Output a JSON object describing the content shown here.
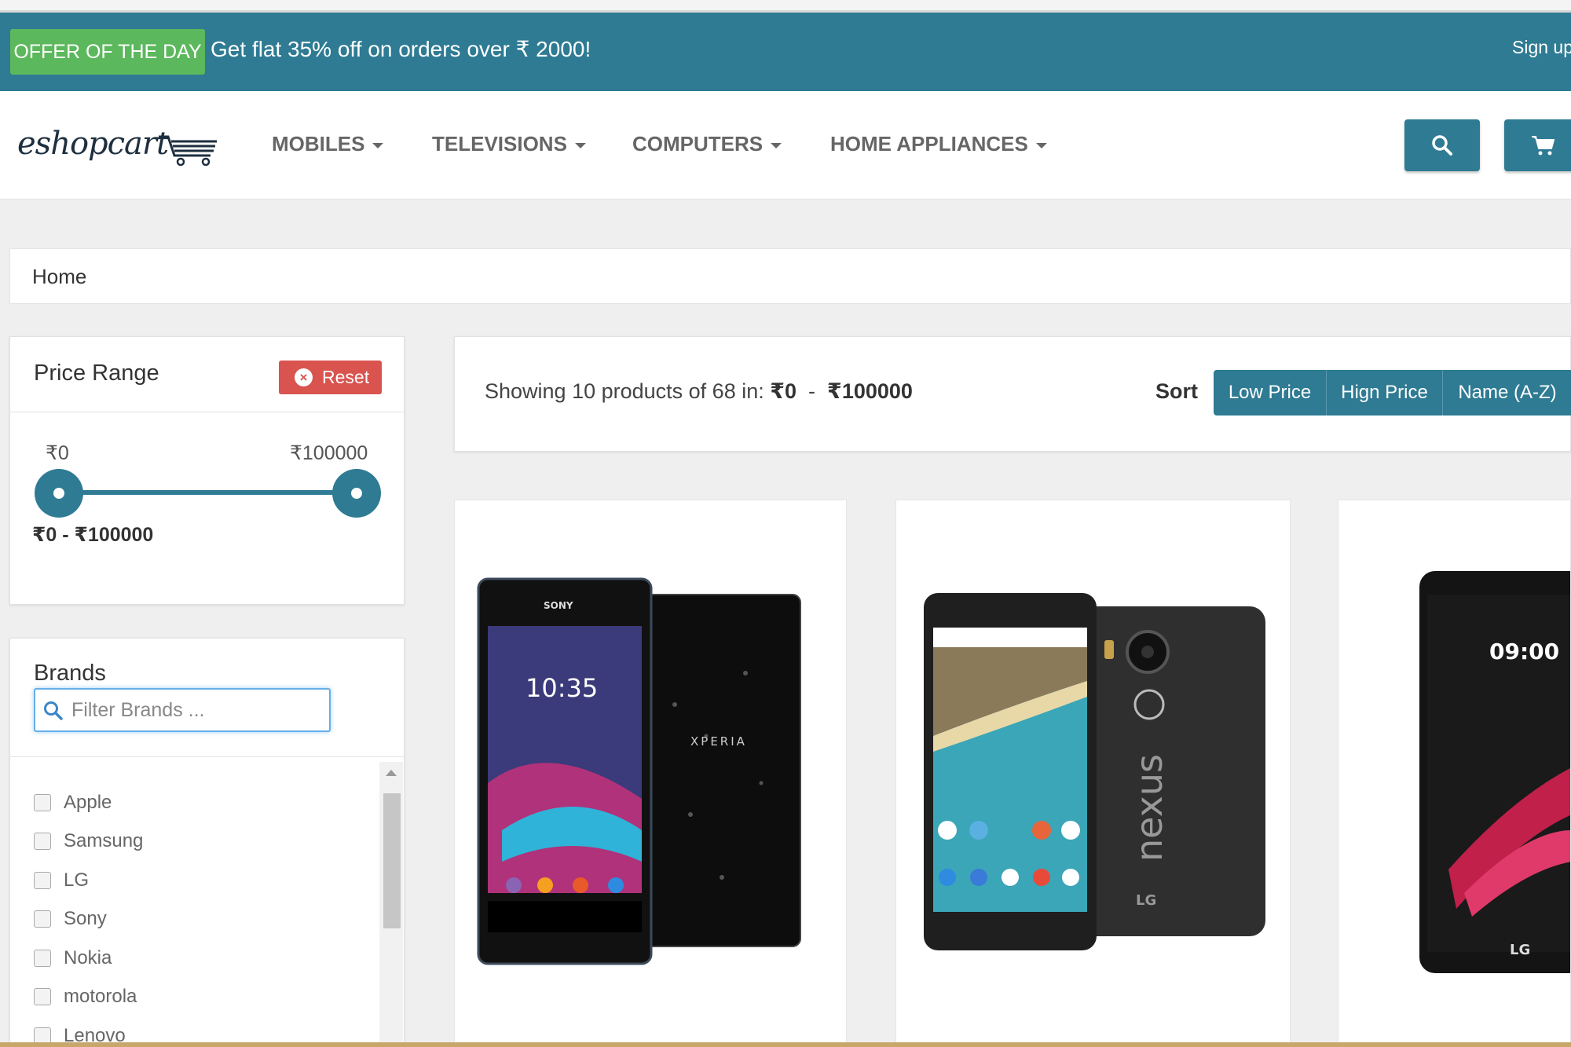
{
  "offer": {
    "badge": "OFFER OF THE DAY",
    "text": "Get flat 35% off on orders over ₹ 2000!",
    "signup": "Sign up"
  },
  "header": {
    "logo_text": "eshopcart",
    "nav": [
      "MOBILES",
      "TELEVISIONS",
      "COMPUTERS",
      "HOME APPLIANCES"
    ],
    "icons": [
      "search-icon",
      "cart-icon"
    ]
  },
  "breadcrumb": {
    "home": "Home"
  },
  "price_filter": {
    "title": "Price Range",
    "reset_label": "Reset",
    "min_label": "₹0",
    "max_label": "₹100000",
    "selected_range": "₹0  -  ₹100000",
    "selected_min_fraction": 0,
    "selected_max_fraction": 1
  },
  "brands_filter": {
    "title": "Brands",
    "placeholder": "Filter Brands ...",
    "items": [
      "Apple",
      "Samsung",
      "LG",
      "Sony",
      "Nokia",
      "motorola",
      "Lenovo"
    ]
  },
  "results": {
    "showing_prefix": "Showing 10 products of 68 in: ",
    "range_min": "₹0",
    "separator": "  -  ",
    "range_max": "₹100000",
    "sort_label": "Sort",
    "sort_options": [
      "Low Price",
      "Hign Price",
      "Name (A-Z)"
    ]
  },
  "products": [
    {
      "image": "Sony Xperia phone",
      "screen_text": "10:35",
      "brand_text": "SONY"
    },
    {
      "image": "LG Nexus phone",
      "screen_text": "nexus",
      "brand_text": "LG"
    },
    {
      "image": "LG phone",
      "screen_text": "09:00",
      "brand_text": "LG"
    }
  ],
  "colors": {
    "primary": "#2e7b93",
    "offer_badge": "#5cb85c",
    "reset": "#d9534f"
  }
}
